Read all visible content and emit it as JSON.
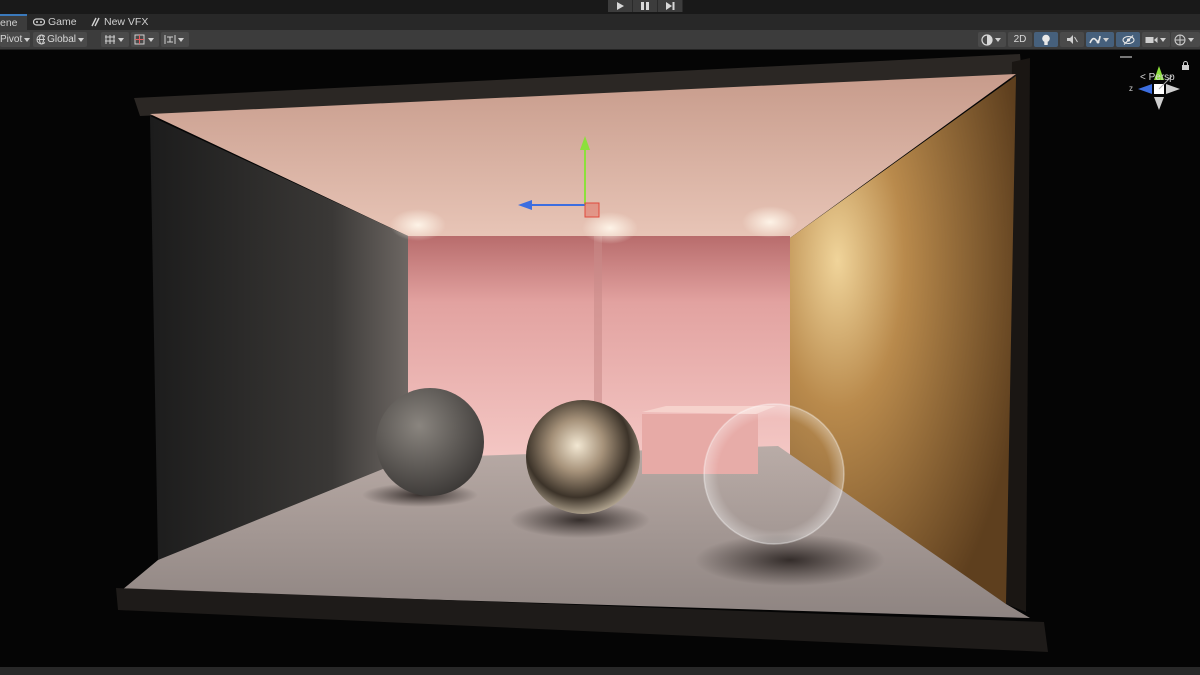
{
  "tabs": [
    {
      "label": "ene",
      "active": true,
      "icon": "scene-icon"
    },
    {
      "label": "Game",
      "active": false,
      "icon": "gamepad-icon"
    },
    {
      "label": "New VFX",
      "active": false,
      "icon": "vfx-graph-icon"
    }
  ],
  "playbar": {
    "play_icon": "play-icon",
    "pause_icon": "pause-icon",
    "step_icon": "step-icon"
  },
  "toolbar": {
    "pivot_label": "Pivot",
    "global_label": "Global",
    "two_d_label": "2D"
  },
  "gizmo": {
    "camera_label": "Persp",
    "z_label": "z"
  },
  "colors": {
    "accent": "#3a79bb",
    "toolbar_bg": "#3c3c3c",
    "toggle_active": "#46607c",
    "gizmo_y": "#8ce03c",
    "gizmo_x": "#e04a3c",
    "gizmo_z": "#3c6ee0"
  }
}
